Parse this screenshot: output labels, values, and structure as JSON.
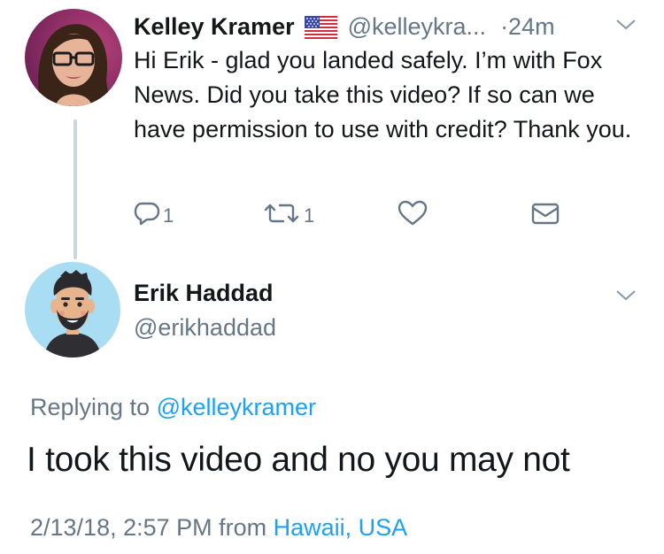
{
  "colors": {
    "text": "#14171a",
    "secondary": "#657786",
    "link": "#1da1f2",
    "thread_line": "#ccd6dd"
  },
  "tweet1": {
    "name": "Kelley Kramer",
    "flag_icon": "us-flag-icon",
    "handle": "@kelleykra...",
    "time": "·24m",
    "text": "Hi Erik - glad you landed safely. I’m with Fox News. Did you take this video? If so can we have permission to use with credit? Thank you.",
    "actions": {
      "reply_icon": "reply-icon",
      "reply_count": "1",
      "retweet_icon": "retweet-icon",
      "retweet_count": "1",
      "like_icon": "heart-icon",
      "dm_icon": "envelope-icon"
    }
  },
  "tweet2": {
    "name": "Erik Haddad",
    "handle": "@erikhaddad",
    "replying_prefix": "Replying to ",
    "replying_mention": "@kelleykramer",
    "text": "I took this video and no you may not",
    "date": "2/13/18, 2:57 PM from ",
    "location": "Hawaii, USA"
  }
}
